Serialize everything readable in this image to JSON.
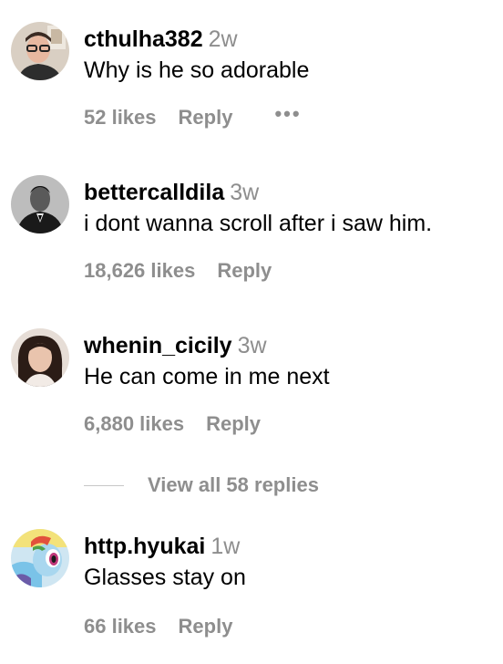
{
  "comments": [
    {
      "username": "cthulha382",
      "time": "2w",
      "text": "Why is he so adorable",
      "likes": "52 likes",
      "reply": "Reply",
      "more": "•••"
    },
    {
      "username": "bettercalldila",
      "time": "3w",
      "text": "i dont wanna scroll after i saw him.",
      "likes": "18,626 likes",
      "reply": "Reply"
    },
    {
      "username": "whenin_cicily",
      "time": "3w",
      "text": "He can come in me next",
      "likes": "6,880 likes",
      "reply": "Reply"
    },
    {
      "username": "http.hyukai",
      "time": "1w",
      "text": "Glasses stay on",
      "likes": "66 likes",
      "reply": "Reply"
    }
  ],
  "view_replies": "View all 58 replies",
  "colors": {
    "secondary_text": "#8e8e8e",
    "primary_text": "#000000"
  }
}
